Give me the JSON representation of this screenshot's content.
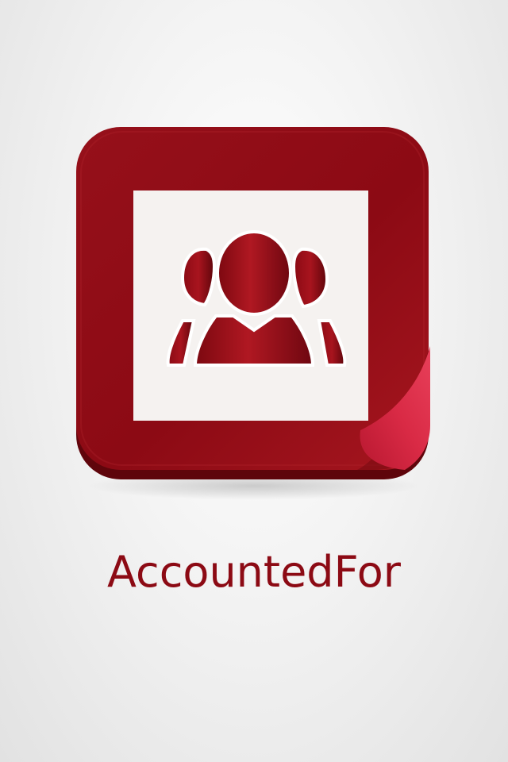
{
  "app": {
    "name": "AccountedFor"
  },
  "icon": {
    "name": "group-people-icon",
    "frame_color": "#8c0a14",
    "frame_highlight": "#a6161f",
    "inner_color": "#f5f2f0",
    "curl_color": "#c8223c"
  },
  "colors": {
    "background": "#ececec",
    "title": "#8c0a14"
  }
}
